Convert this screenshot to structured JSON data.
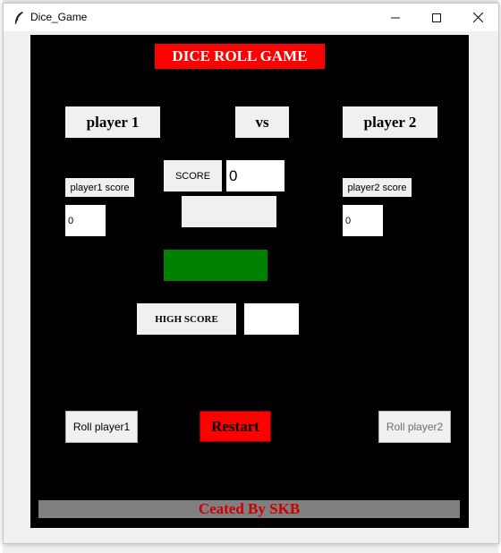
{
  "window": {
    "title": "Dice_Game",
    "controls": {
      "minimize": "minimize-icon",
      "maximize": "maximize-icon",
      "close": "close-icon"
    }
  },
  "colors": {
    "canvas": "#000000",
    "title_banner": "#ff0000",
    "dice_indicator": "#008000",
    "restart_button": "#ff0000",
    "footer_bar": "#808080",
    "footer_text": "#cc0000"
  },
  "game": {
    "title": "DICE ROLL GAME",
    "player1_label": "player 1",
    "vs_label": "vs",
    "player2_label": "player 2",
    "score_label": "SCORE",
    "score_value": "0",
    "dice_display": "",
    "player1_score_label": "player1 score",
    "player1_score_value": "0",
    "player2_score_label": "player2 score",
    "player2_score_value": "0",
    "high_score_label": "HIGH SCORE",
    "high_score_value": "",
    "roll_player1": "Roll player1",
    "restart": "Restart",
    "roll_player2": "Roll player2",
    "footer": "Ceated By SKB"
  }
}
